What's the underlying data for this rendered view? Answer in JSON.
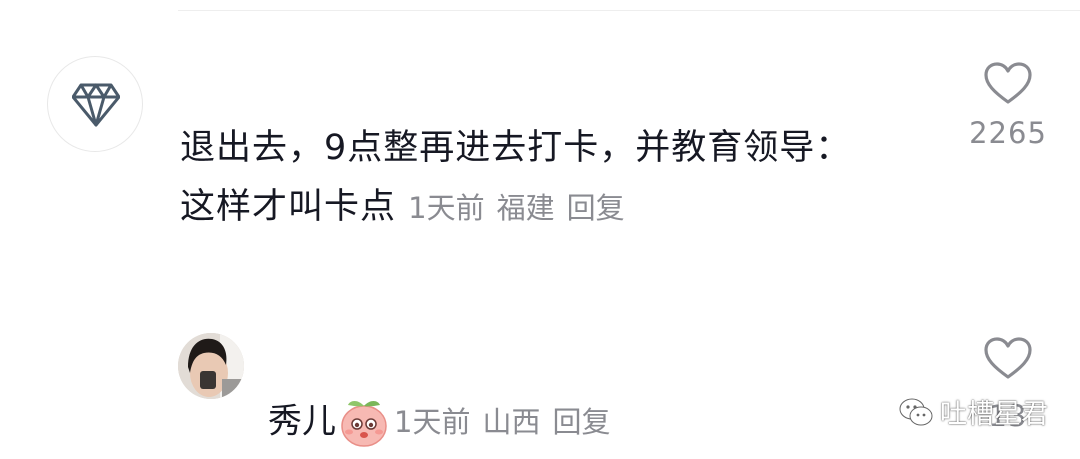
{
  "comments": [
    {
      "avatar_icon": "diamond-icon",
      "text_line1": "退出去，9点整再进去打卡，并教育领导：",
      "text_line2": "这样才叫卡点",
      "time": "1天前",
      "location": "福建",
      "reply_label": "回复",
      "like_count": "2265"
    }
  ],
  "reply": {
    "author": "秀儿",
    "emoji": "peach-emoji",
    "time": "1天前",
    "location": "山西",
    "reply_label": "回复",
    "like_count": "13"
  },
  "watermark": {
    "icon": "wechat-icon",
    "text": "吐槽星君"
  },
  "colors": {
    "text_primary": "#161823",
    "text_secondary": "#8a8b91",
    "heart_outline": "#8a8b91"
  }
}
